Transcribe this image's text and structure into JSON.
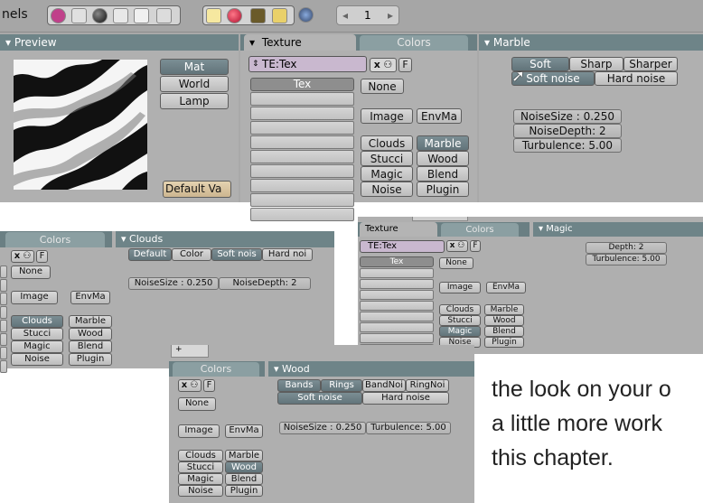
{
  "toolbar": {
    "label": "nels",
    "page": "1",
    "icons": [
      "shading-icon",
      "object-icon",
      "material-sphere-icon",
      "constraint-icon",
      "texture-icon",
      "image-icon",
      "lamp-icon",
      "material-red-icon",
      "texture-pattern-icon",
      "radiosity-icon",
      "world-icon"
    ]
  },
  "top": {
    "preview": {
      "title": "Preview",
      "buttons": [
        "Mat",
        "World",
        "Lamp"
      ],
      "default": "Default Va"
    },
    "texture": {
      "tab_active": "Texture",
      "tab_other": "Colors",
      "selector": "TE:Tex",
      "x": "x",
      "f": "F",
      "slot": "Tex",
      "none": "None",
      "image": "Image",
      "envmap": "EnvMa",
      "types": [
        "Clouds",
        "Marble",
        "Stucci",
        "Wood",
        "Magic",
        "Blend",
        "Noise",
        "Plugin"
      ]
    },
    "marble": {
      "title": "Marble",
      "types": [
        "Soft",
        "Sharp",
        "Sharper"
      ],
      "noise": [
        "Soft noise",
        "Hard noise"
      ],
      "fields": [
        "NoiseSize : 0.250",
        "NoiseDepth: 2",
        "Turbulence: 5.00"
      ]
    }
  },
  "clouds_shot": {
    "tab": "Colors",
    "title": "Clouds",
    "x": "x",
    "f": "F",
    "none": "None",
    "image": "Image",
    "envmap": "EnvMa",
    "types": [
      "Clouds",
      "Marble",
      "Stucci",
      "Wood",
      "Magic",
      "Blend",
      "Noise",
      "Plugin"
    ],
    "mode": [
      "Default",
      "Color",
      "Soft nois",
      "Hard noi"
    ],
    "fields": [
      "NoiseSize : 0.250",
      "NoiseDepth: 2"
    ]
  },
  "magic_shot": {
    "tab_active": "Texture",
    "tab_other": "Colors",
    "title": "Magic",
    "selector": "TE:Tex",
    "x": "x",
    "f": "F",
    "slot": "Tex",
    "none": "None",
    "image": "Image",
    "envmap": "EnvMa",
    "types": [
      "Clouds",
      "Marble",
      "Stucci",
      "Wood",
      "Magic",
      "Blend",
      "Noise",
      "Plugin"
    ],
    "fields": [
      "Depth: 2",
      "Turbulence: 5.00"
    ]
  },
  "wood_shot": {
    "tab": "Colors",
    "title": "Wood",
    "x": "x",
    "f": "F",
    "none": "None",
    "image": "Image",
    "envmap": "EnvMa",
    "types": [
      "Clouds",
      "Marble",
      "Stucci",
      "Wood",
      "Magic",
      "Blend",
      "Noise",
      "Plugin"
    ],
    "mode": [
      "Bands",
      "Rings",
      "BandNoi",
      "RingNoi"
    ],
    "noise": [
      "Soft noise",
      "Hard noise"
    ],
    "fields": [
      "NoiseSize : 0.250",
      "Turbulence: 5.00"
    ]
  },
  "caption": {
    "line1": "the look on your o",
    "line2": "a little more work",
    "line3": "this chapter."
  }
}
